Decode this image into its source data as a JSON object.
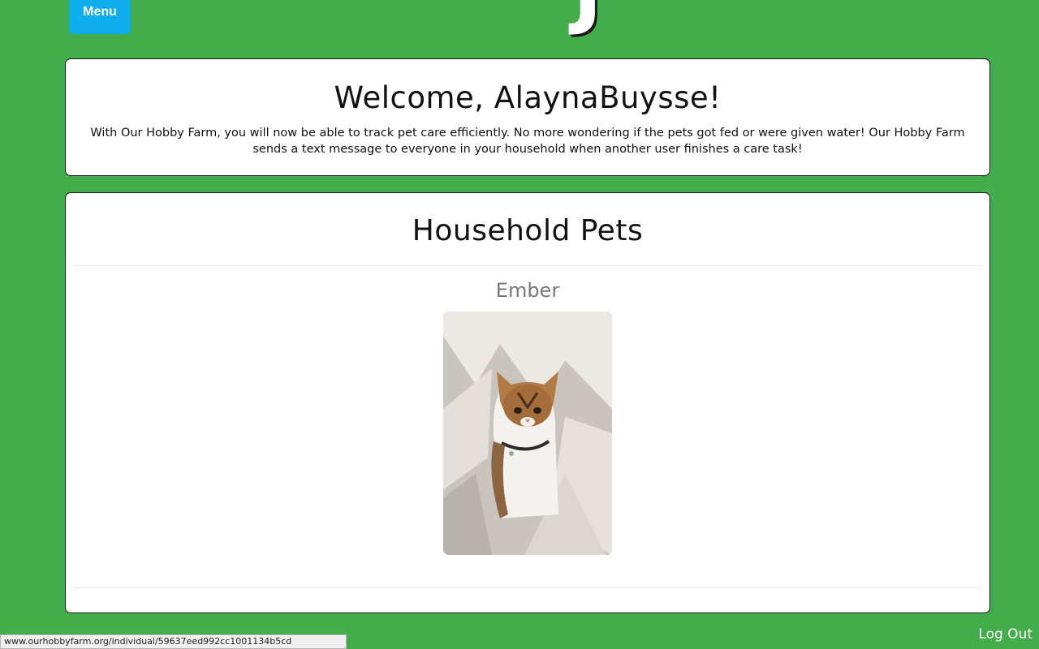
{
  "header": {
    "menu_label": "Menu",
    "logo_glyph": "J"
  },
  "welcome": {
    "title": "Welcome, AlaynaBuysse!",
    "message": "With Our Hobby Farm, you will now be able to track pet care efficiently. No more wondering if the pets got fed or were given water! Our Hobby Farm sends a text message to everyone in your household when another user finishes a care task!"
  },
  "pets": {
    "title": "Household Pets",
    "items": [
      {
        "name": "Ember"
      }
    ]
  },
  "footer": {
    "status_url": "www.ourhobbyfarm.org/individual/59637eed992cc1001134b5cd",
    "logout_label": "Log Out"
  },
  "colors": {
    "background": "#43ad4b",
    "menu_button": "#0eadee",
    "card": "#ffffff"
  }
}
